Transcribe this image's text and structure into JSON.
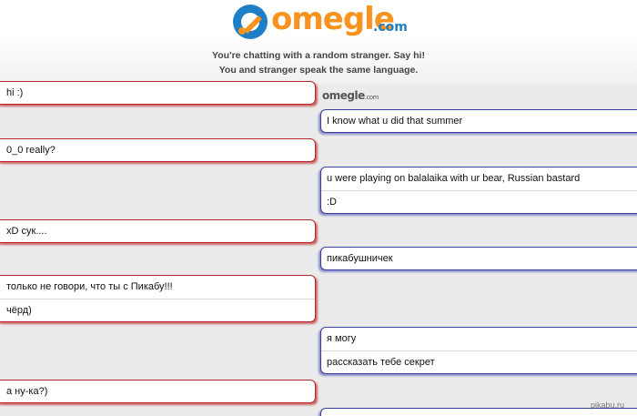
{
  "header": {
    "logo_text": "omegle",
    "logo_suffix": ".com",
    "status_line_1": "You're chatting with a random stranger. Say hi!",
    "status_line_2": "You and stranger speak the same language."
  },
  "mini_logo": {
    "text": "omegle",
    "suffix": ".com"
  },
  "messages": [
    {
      "from": "you",
      "lines": [
        "hi :)"
      ]
    },
    {
      "from": "stranger",
      "lines": [
        "I know what u did that summer"
      ]
    },
    {
      "from": "you",
      "lines": [
        "0_0 really?"
      ]
    },
    {
      "from": "stranger",
      "lines": [
        "u were playing on balalaika with ur bear, Russian bastard",
        ":D"
      ]
    },
    {
      "from": "you",
      "lines": [
        "xD сук...."
      ]
    },
    {
      "from": "stranger",
      "lines": [
        "пикабушничек"
      ]
    },
    {
      "from": "you",
      "lines": [
        "только не говори, что ты с Пикабу!!!",
        "чёрд)"
      ]
    },
    {
      "from": "stranger",
      "lines": [
        "я могу",
        "рассказать тебе секрет"
      ]
    },
    {
      "from": "you",
      "lines": [
        "а ну-ка?)"
      ]
    },
    {
      "from": "stranger",
      "lines": [
        ""
      ]
    }
  ],
  "watermark": "pikabu.ru",
  "colors": {
    "you_border": "#b8282a",
    "stranger_border": "#3a3f9e",
    "logo_orange": "#f7931e",
    "logo_blue": "#1e7fc6"
  }
}
